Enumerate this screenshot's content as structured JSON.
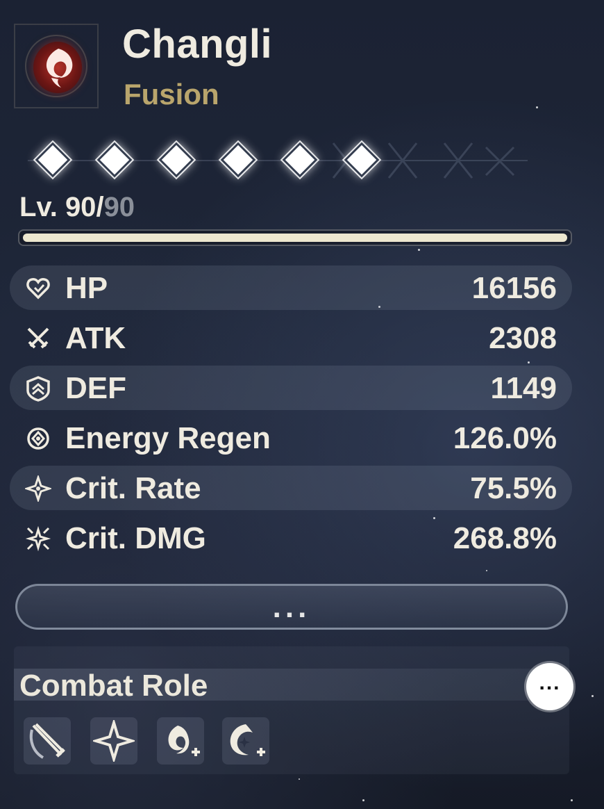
{
  "character": {
    "name": "Changli",
    "element": "Fusion",
    "element_icon": "fusion-flame-icon",
    "element_color": "#b9a56c"
  },
  "sequence": {
    "nodes_unlocked": 6,
    "nodes_total": 6
  },
  "level": {
    "prefix": "Lv. ",
    "current": "90",
    "separator": "/",
    "max": "90",
    "progress": 1.0
  },
  "stats": [
    {
      "icon": "heart-icon",
      "label": "HP",
      "value": "16156"
    },
    {
      "icon": "crossed-swords-icon",
      "label": "ATK",
      "value": "2308"
    },
    {
      "icon": "shield-icon",
      "label": "DEF",
      "value": "1149"
    },
    {
      "icon": "energy-regen-icon",
      "label": "Energy Regen",
      "value": "126.0%"
    },
    {
      "icon": "crit-rate-icon",
      "label": "Crit. Rate",
      "value": "75.5%"
    },
    {
      "icon": "crit-dmg-icon",
      "label": "Crit. DMG",
      "value": "268.8%"
    }
  ],
  "more_button": {
    "label": "..."
  },
  "combat_role": {
    "title": "Combat Role",
    "info_button": "...",
    "roles": [
      {
        "icon": "blade-slash-icon"
      },
      {
        "icon": "sparkle-star-icon"
      },
      {
        "icon": "fusion-boost-icon"
      },
      {
        "icon": "swirl-boost-icon"
      }
    ]
  },
  "colors": {
    "accent_gold": "#b9a56c",
    "text": "#efebe0",
    "level_bar": "#ede7cf"
  }
}
